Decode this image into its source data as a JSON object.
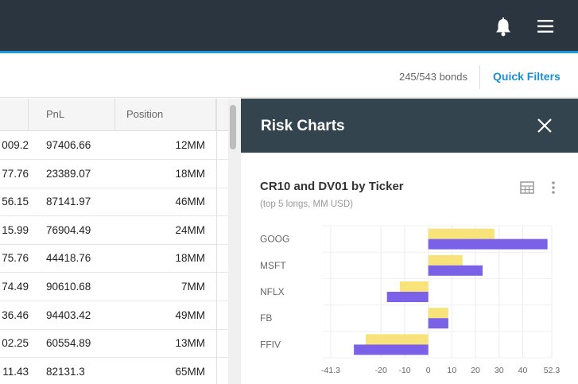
{
  "header": {
    "bell_icon": "bell-icon",
    "menu_icon": "menu-icon"
  },
  "filters": {
    "count": "245/543 bonds",
    "quick_filters": "Quick Filters"
  },
  "grid": {
    "columns": [
      "PnL",
      "Position"
    ],
    "rows": [
      {
        "prev": "009.2",
        "pnl": "97406.66",
        "position": "12MM"
      },
      {
        "prev": "77.76",
        "pnl": "23389.07",
        "position": "18MM"
      },
      {
        "prev": "56.15",
        "pnl": "87141.97",
        "position": "46MM"
      },
      {
        "prev": "15.99",
        "pnl": "76904.49",
        "position": "24MM"
      },
      {
        "prev": "75.76",
        "pnl": "44418.76",
        "position": "18MM"
      },
      {
        "prev": "74.49",
        "pnl": "90610.68",
        "position": "7MM"
      },
      {
        "prev": "36.46",
        "pnl": "94403.42",
        "position": "49MM"
      },
      {
        "prev": "02.25",
        "pnl": "60554.89",
        "position": "13MM"
      },
      {
        "prev": "11.43",
        "pnl": "82131.3",
        "position": "65MM"
      }
    ]
  },
  "panel": {
    "title": "Risk Charts",
    "close_icon": "close-icon"
  },
  "chart_data": {
    "type": "bar",
    "orientation": "horizontal",
    "title": "CR10 and DV01 by Ticker",
    "subtitle": "(top 5 longs, MM USD)",
    "categories": [
      "GOOG",
      "MSFT",
      "NFLX",
      "FB",
      "FFIV"
    ],
    "series": [
      {
        "color": "#f8e27a",
        "values": [
          28,
          14.5,
          -12,
          8.5,
          -26.5
        ]
      },
      {
        "color": "#7b61e8",
        "values": [
          50.5,
          23,
          -17.5,
          8.5,
          -31.5
        ]
      }
    ],
    "xlim": [
      -41.3,
      52.3
    ],
    "xticks": [
      "-41.3",
      "-20",
      "-10",
      "0",
      "10",
      "20",
      "30",
      "40",
      "52.3"
    ],
    "xtick_values": [
      -41.3,
      -20,
      -10,
      0,
      10,
      20,
      30,
      40,
      52.3
    ],
    "grid": true,
    "legend": "none"
  }
}
